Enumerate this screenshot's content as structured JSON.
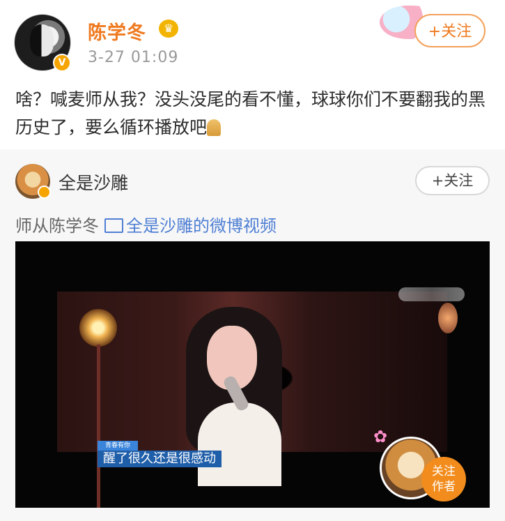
{
  "post": {
    "author": "陈学冬",
    "time": "3-27 01:09",
    "follow": "+关注",
    "content": "啥？喊麦师从我？没头没尾的看不懂，球球你们不要翻我的黑历史了，要么循环播放吧"
  },
  "repost": {
    "username": "全是沙雕",
    "follow": "+关注",
    "caption_prefix": "师从陈学冬",
    "video_link": "全是沙雕的微博视频"
  },
  "video": {
    "tag": "青春有你",
    "subtitle": "醒了很久还是很感动",
    "follow_author": "关注\n作者"
  },
  "colors": {
    "orange": "#ef7a20",
    "blue_link": "#4f7fd4"
  },
  "icons": [
    "verified-badge-icon",
    "crown-icon",
    "pray-icon",
    "video-icon",
    "flower-icon"
  ]
}
